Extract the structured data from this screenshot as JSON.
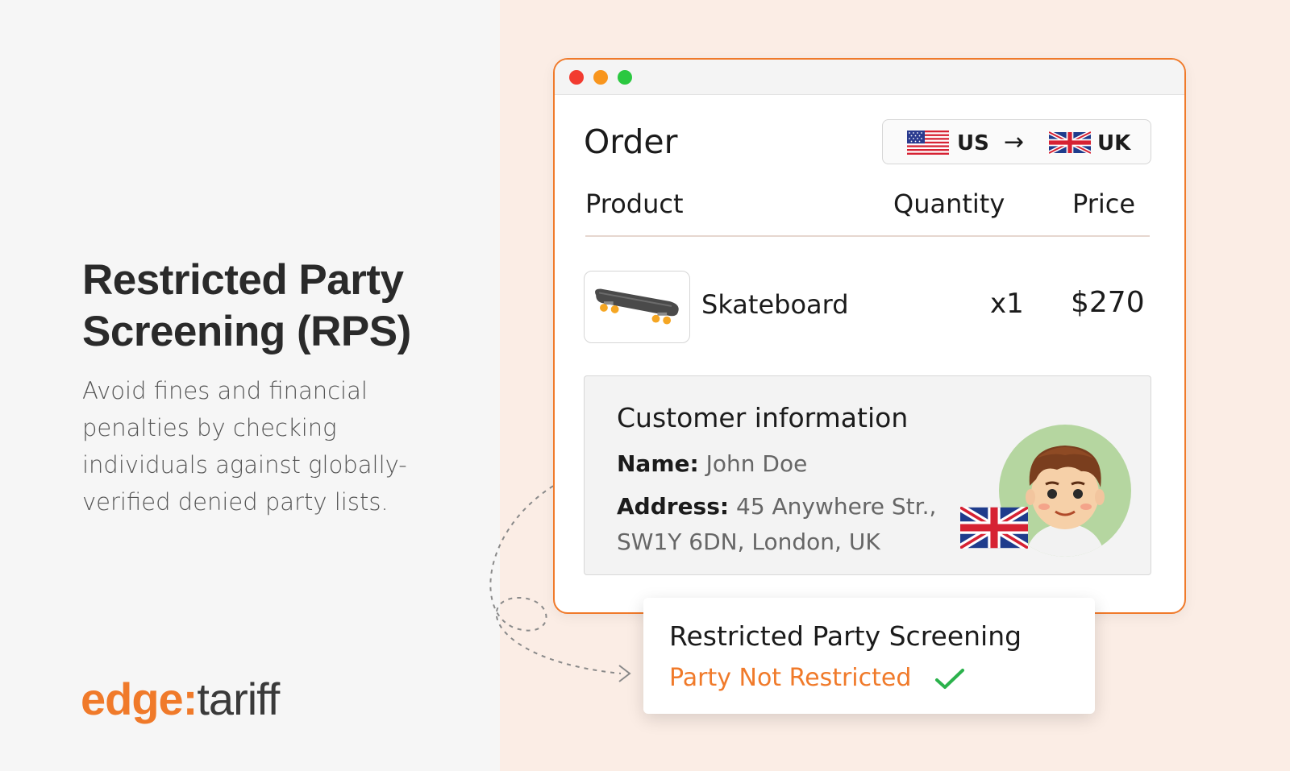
{
  "hero": {
    "headline_line1": "Restricted Party",
    "headline_line2": "Screening (RPS)",
    "sub_line1": "Avoid fines and financial",
    "sub_line2": "penalties by checking",
    "sub_line3": "individuals against globally-",
    "sub_line4": "verified denied party lists."
  },
  "logo": {
    "part1": "edge:",
    "part2": "tariff"
  },
  "order": {
    "title": "Order",
    "route": {
      "from": "US",
      "arrow": "→",
      "to": "UK"
    },
    "columns": {
      "product": "Product",
      "quantity": "Quantity",
      "price": "Price"
    },
    "items": [
      {
        "name": "Skateboard",
        "quantity": "x1",
        "price": "$270",
        "icon": "skateboard-icon"
      }
    ]
  },
  "customer": {
    "title": "Customer information",
    "name_label": "Name:",
    "name_value": "John Doe",
    "address_label": "Address:",
    "address_line1": "45 Anywhere Str.,",
    "address_line2": "SW1Y 6DN, London, UK"
  },
  "screening": {
    "title": "Restricted Party Screening",
    "status": "Party Not Restricted"
  },
  "colors": {
    "accent": "#f07a2a",
    "right_panel_bg": "#fbede5",
    "left_panel_bg": "#f6f6f6",
    "check": "#2bb24c"
  },
  "icons": [
    "us-flag-icon",
    "uk-flag-icon",
    "arrow-right-icon",
    "skateboard-icon",
    "avatar-icon",
    "check-icon"
  ]
}
